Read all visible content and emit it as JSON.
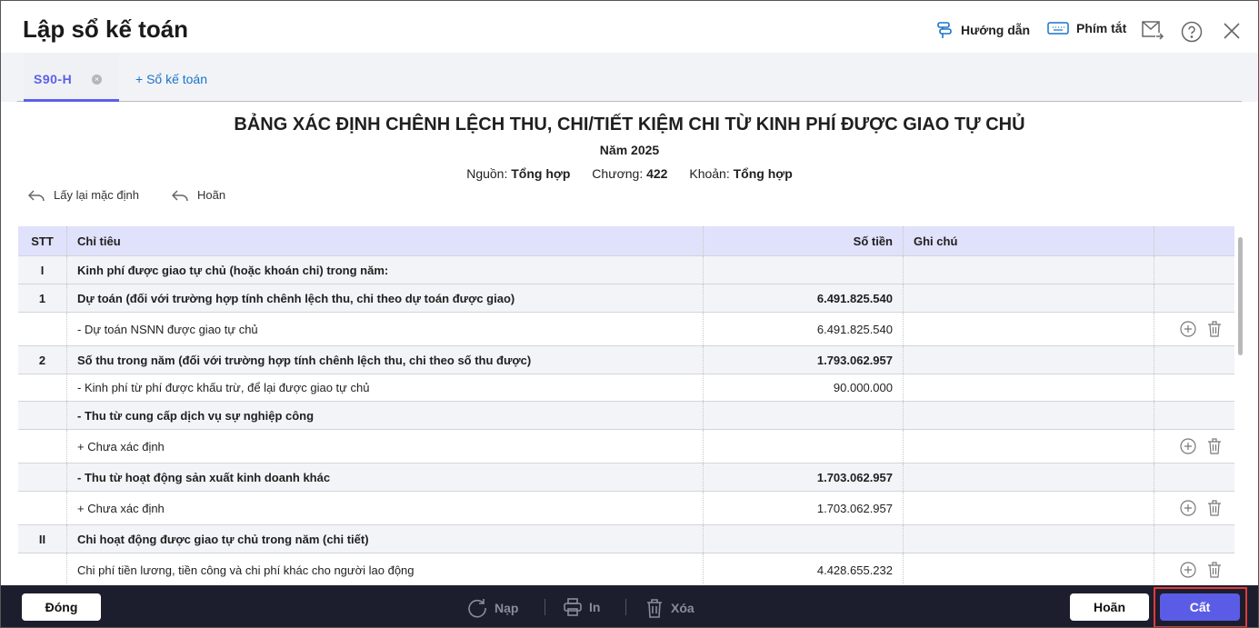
{
  "window": {
    "title": "Lập sổ kế toán",
    "guide_label": "Hướng dẫn",
    "shortcut_label": "Phím tắt"
  },
  "tabs": [
    {
      "label": "S90-H",
      "active": true
    }
  ],
  "add_tab_label": "+ Sổ kế toán",
  "report": {
    "title": "BẢNG XÁC ĐỊNH CHÊNH LỆCH THU, CHI/TIẾT KIỆM CHI TỪ KINH PHÍ ĐƯỢC GIAO TỰ CHỦ",
    "year": "Năm 2025",
    "source_label": "Nguồn:",
    "source_value": "Tổng hợp",
    "chapter_label": "Chương:",
    "chapter_value": "422",
    "item_label": "Khoản:",
    "item_value": "Tổng hợp"
  },
  "toolbar": {
    "reset_label": "Lấy lại mặc định",
    "undo_label": "Hoãn"
  },
  "table": {
    "headers": {
      "stt": "STT",
      "indicator": "Chỉ tiêu",
      "amount": "Số tiền",
      "note": "Ghi chú"
    },
    "rows": [
      {
        "stt": "I",
        "indicator": "Kinh phí được giao tự chủ (hoặc khoán chi) trong năm:",
        "amount": "",
        "note": "",
        "bold": true,
        "gray": true,
        "actions": false
      },
      {
        "stt": "1",
        "indicator": "Dự toán (đối với trường hợp tính chênh lệch thu, chi theo dự toán được giao)",
        "amount": "6.491.825.540",
        "note": "",
        "bold": true,
        "gray": true,
        "actions": false
      },
      {
        "stt": "",
        "indicator": "- Dự toán NSNN được giao tự chủ",
        "amount": "6.491.825.540",
        "note": "",
        "bold": false,
        "gray": false,
        "actions": true
      },
      {
        "stt": "2",
        "indicator": "Số thu trong năm (đối với trường hợp tính chênh lệch thu, chi theo số thu được)",
        "amount": "1.793.062.957",
        "note": "",
        "bold": true,
        "gray": true,
        "actions": false
      },
      {
        "stt": "",
        "indicator": "- Kinh phí từ phí được khấu trừ, để lại được giao tự chủ",
        "amount": "90.000.000",
        "note": "",
        "bold": false,
        "gray": false,
        "actions": false
      },
      {
        "stt": "",
        "indicator": "- Thu từ cung cấp dịch vụ sự nghiệp công",
        "amount": "",
        "note": "",
        "bold": true,
        "gray": true,
        "actions": false
      },
      {
        "stt": "",
        "indicator": "+ Chưa xác định",
        "amount": "",
        "note": "",
        "bold": false,
        "gray": false,
        "actions": true
      },
      {
        "stt": "",
        "indicator": "- Thu từ hoạt động sản xuất kinh doanh khác",
        "amount": "1.703.062.957",
        "note": "",
        "bold": true,
        "gray": true,
        "actions": false
      },
      {
        "stt": "",
        "indicator": "+ Chưa xác định",
        "amount": "1.703.062.957",
        "note": "",
        "bold": false,
        "gray": false,
        "actions": true
      },
      {
        "stt": "II",
        "indicator": "Chi hoạt động được giao tự chủ trong năm (chi tiết)",
        "amount": "",
        "note": "",
        "bold": true,
        "gray": true,
        "actions": false
      },
      {
        "stt": "",
        "indicator": "Chi phí tiền lương, tiền công và chi phí khác cho người lao động",
        "amount": "4.428.655.232",
        "note": "",
        "bold": false,
        "gray": false,
        "actions": true
      }
    ]
  },
  "footer": {
    "close_label": "Đóng",
    "reload_label": "Nạp",
    "print_label": "In",
    "delete_label": "Xóa",
    "undo_label": "Hoãn",
    "save_label": "Cất"
  },
  "colors": {
    "accent": "#5b5fe8",
    "footer_bg": "#1c1e2e",
    "header_bg": "#e0e1fa",
    "highlight": "#e53935"
  }
}
